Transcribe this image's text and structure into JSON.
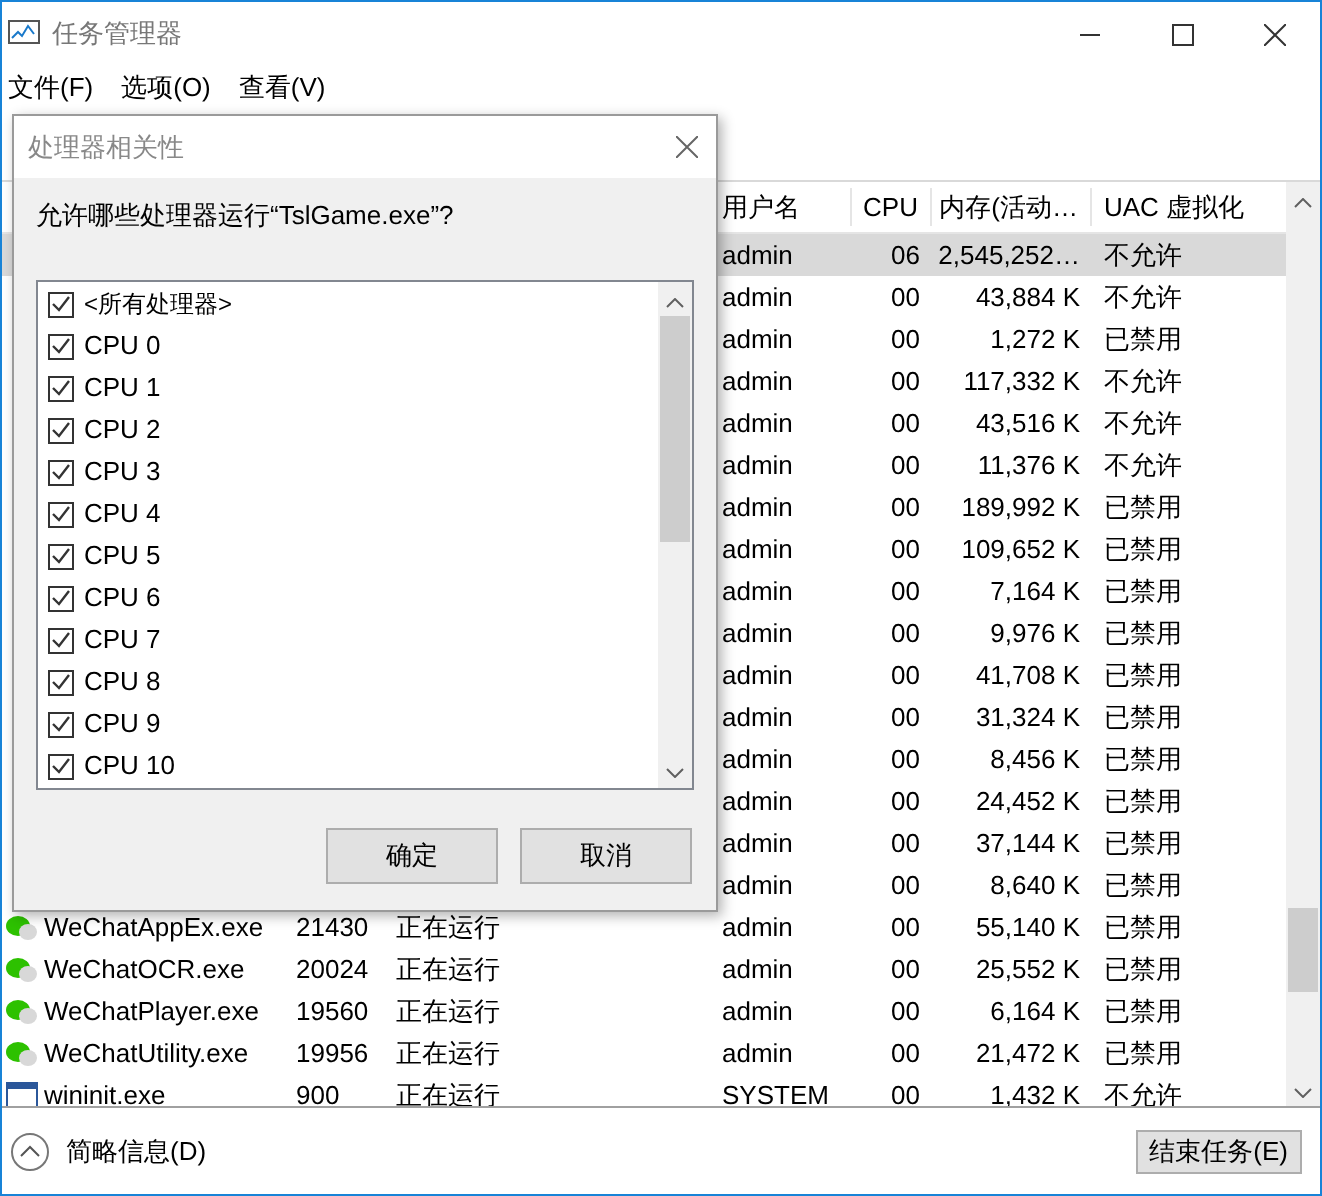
{
  "window": {
    "title": "任务管理器"
  },
  "menu": [
    "文件(F)",
    "选项(O)",
    "查看(V)"
  ],
  "table": {
    "columns": [
      "用户名",
      "CPU",
      "内存(活动…",
      "UAC 虚拟化"
    ],
    "rows": [
      {
        "user": "admin",
        "cpu": "06",
        "memory": "2,545,252…",
        "uac": "不允许",
        "selected": true
      },
      {
        "user": "admin",
        "cpu": "00",
        "memory": "43,884 K",
        "uac": "不允许",
        "selected": false
      },
      {
        "user": "admin",
        "cpu": "00",
        "memory": "1,272 K",
        "uac": "已禁用",
        "selected": false
      },
      {
        "user": "admin",
        "cpu": "00",
        "memory": "117,332 K",
        "uac": "不允许",
        "selected": false
      },
      {
        "user": "admin",
        "cpu": "00",
        "memory": "43,516 K",
        "uac": "不允许",
        "selected": false
      },
      {
        "user": "admin",
        "cpu": "00",
        "memory": "11,376 K",
        "uac": "不允许",
        "selected": false
      },
      {
        "user": "admin",
        "cpu": "00",
        "memory": "189,992 K",
        "uac": "已禁用",
        "selected": false
      },
      {
        "user": "admin",
        "cpu": "00",
        "memory": "109,652 K",
        "uac": "已禁用",
        "selected": false
      },
      {
        "user": "admin",
        "cpu": "00",
        "memory": "7,164 K",
        "uac": "已禁用",
        "selected": false
      },
      {
        "user": "admin",
        "cpu": "00",
        "memory": "9,976 K",
        "uac": "已禁用",
        "selected": false
      },
      {
        "user": "admin",
        "cpu": "00",
        "memory": "41,708 K",
        "uac": "已禁用",
        "selected": false
      },
      {
        "user": "admin",
        "cpu": "00",
        "memory": "31,324 K",
        "uac": "已禁用",
        "selected": false
      },
      {
        "user": "admin",
        "cpu": "00",
        "memory": "8,456 K",
        "uac": "已禁用",
        "selected": false
      },
      {
        "user": "admin",
        "cpu": "00",
        "memory": "24,452 K",
        "uac": "已禁用",
        "selected": false
      },
      {
        "user": "admin",
        "cpu": "00",
        "memory": "37,144 K",
        "uac": "已禁用",
        "selected": false
      },
      {
        "user": "admin",
        "cpu": "00",
        "memory": "8,640 K",
        "uac": "已禁用",
        "selected": false
      },
      {
        "kind": "wechat",
        "name": "WeChatAppEx.exe",
        "pid": "21430",
        "status": "正在运行",
        "user": "admin",
        "cpu": "00",
        "memory": "55,140 K",
        "uac": "已禁用",
        "selected": false
      },
      {
        "kind": "wechat",
        "name": "WeChatOCR.exe",
        "pid": "20024",
        "status": "正在运行",
        "user": "admin",
        "cpu": "00",
        "memory": "25,552 K",
        "uac": "已禁用",
        "selected": false
      },
      {
        "kind": "wechat",
        "name": "WeChatPlayer.exe",
        "pid": "19560",
        "status": "正在运行",
        "user": "admin",
        "cpu": "00",
        "memory": "6,164 K",
        "uac": "已禁用",
        "selected": false
      },
      {
        "kind": "wechat",
        "name": "WeChatUtility.exe",
        "pid": "19956",
        "status": "正在运行",
        "user": "admin",
        "cpu": "00",
        "memory": "21,472 K",
        "uac": "已禁用",
        "selected": false
      },
      {
        "kind": "system",
        "name": "wininit.exe",
        "pid": "900",
        "status": "正在运行",
        "user": "SYSTEM",
        "cpu": "00",
        "memory": "1,432 K",
        "uac": "不允许",
        "selected": false
      }
    ]
  },
  "footer": {
    "details": "简略信息(D)",
    "end_task": "结束任务(E)"
  },
  "dialog": {
    "title": "处理器相关性",
    "prompt": "允许哪些处理器运行“TslGame.exe”?",
    "items": [
      {
        "label": "<所有处理器>",
        "checked": true
      },
      {
        "label": "CPU 0",
        "checked": true
      },
      {
        "label": "CPU 1",
        "checked": true
      },
      {
        "label": "CPU 2",
        "checked": true
      },
      {
        "label": "CPU 3",
        "checked": true
      },
      {
        "label": "CPU 4",
        "checked": true
      },
      {
        "label": "CPU 5",
        "checked": true
      },
      {
        "label": "CPU 6",
        "checked": true
      },
      {
        "label": "CPU 7",
        "checked": true
      },
      {
        "label": "CPU 8",
        "checked": true
      },
      {
        "label": "CPU 9",
        "checked": true
      },
      {
        "label": "CPU 10",
        "checked": true
      }
    ],
    "buttons": [
      "确定",
      "取消"
    ]
  }
}
